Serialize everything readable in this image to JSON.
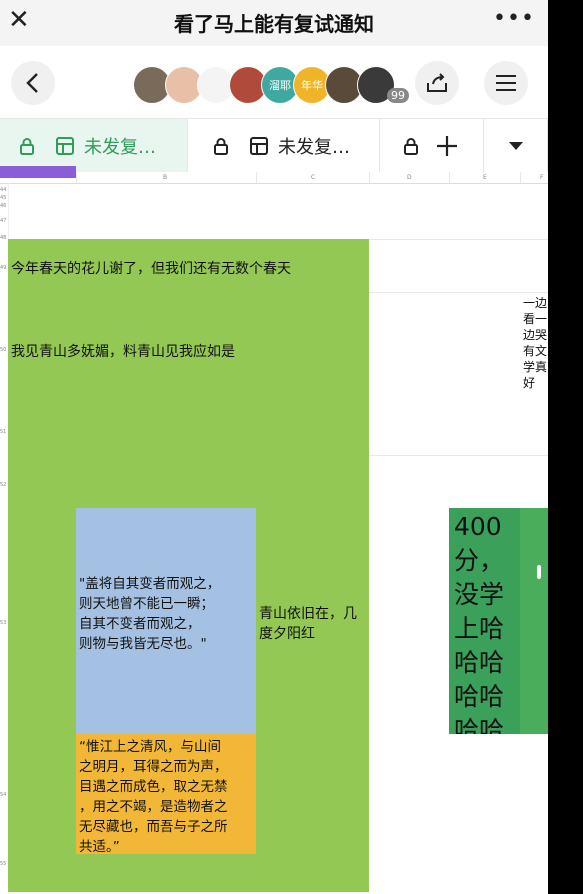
{
  "topbar": {
    "title": "看了马上能有复试通知",
    "close_icon": "close-icon",
    "more_icon": "more-icon"
  },
  "toolbar": {
    "avatars": [
      {
        "label": "",
        "color": "#7a6a5a"
      },
      {
        "label": "",
        "color": "#e8c0a8"
      },
      {
        "label": "",
        "color": "#f4f4f4"
      },
      {
        "label": "",
        "color": "#b04a3a"
      },
      {
        "label": "溜耶",
        "color": "#3fa8a0"
      },
      {
        "label": "年华",
        "color": "#f0b428"
      },
      {
        "label": "",
        "color": "#5a4a3a"
      },
      {
        "label": "",
        "color": "#3a3a3a"
      }
    ],
    "avatar_overflow": "99"
  },
  "tabs": [
    {
      "label": "未发复…"
    },
    {
      "label": "未发复…"
    }
  ],
  "sheet": {
    "columns": [
      "B",
      "C",
      "D",
      "E",
      "F"
    ],
    "rows": [
      "44",
      "45",
      "46",
      "47",
      "48",
      "49",
      "50",
      "51",
      "52",
      "53",
      "54",
      "55"
    ],
    "cells": {
      "r49": "今年春天的花儿谢了，但我们还有无数个春天",
      "r50": "我见青山多妩媚，料青山见我应如是",
      "quote1": [
        "\"盖将自其变者而观之，",
        "则天地曾不能已一瞬；",
        "自其不变者而观之，",
        "则物与我皆无尽也。\""
      ],
      "qingshan": [
        "青山依旧在，几",
        "度夕阳红"
      ],
      "quote2": [
        "“惟江上之清风，与山间",
        "之明月，耳得之而为声，",
        "目遇之而成色，取之无禁",
        "，用之不竭，是造物者之",
        "无尽藏也，而吾与子之所",
        "共适。”"
      ],
      "teal": [
        "400",
        "分，",
        "没学",
        "上哈",
        "哈哈",
        "哈哈",
        "哈哈"
      ],
      "right": [
        "一边",
        "看一",
        "边哭",
        "有文",
        "学真",
        "好"
      ]
    }
  }
}
